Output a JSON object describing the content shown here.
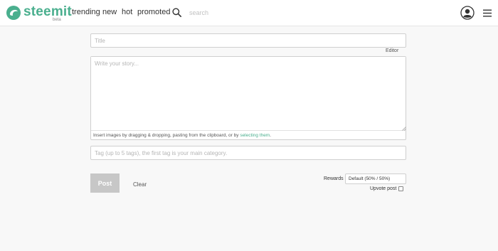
{
  "header": {
    "brand": "steemit",
    "beta": "beta",
    "nav": [
      {
        "label": "trending"
      },
      {
        "label": "new"
      },
      {
        "label": "hot"
      },
      {
        "label": "promoted"
      }
    ],
    "search_placeholder": "search",
    "icons": {
      "logo": "steemit-logo-icon",
      "search": "search-icon",
      "avatar": "user-avatar-icon",
      "menu": "hamburger-menu-icon"
    }
  },
  "editor": {
    "title_placeholder": "Title",
    "editor_toggle": "Editor",
    "body_placeholder": "Write your story...",
    "upload_hint": "Insert images by dragging & dropping, pasting from the clipboard, or by ",
    "upload_link": "selecting them",
    "upload_end": ".",
    "tags_placeholder": "Tag (up to 5 tags), the first tag is your main category.",
    "post_label": "Post",
    "clear_label": "Clear",
    "rewards_label": "Rewards",
    "rewards_value": "Default (50% / 50%)",
    "upvote_label": "Upvote post",
    "upvote_checked": false
  },
  "colors": {
    "brand": "#4aaf8e",
    "post_button": "#c7c7c7",
    "background": "#f8f8f8"
  }
}
